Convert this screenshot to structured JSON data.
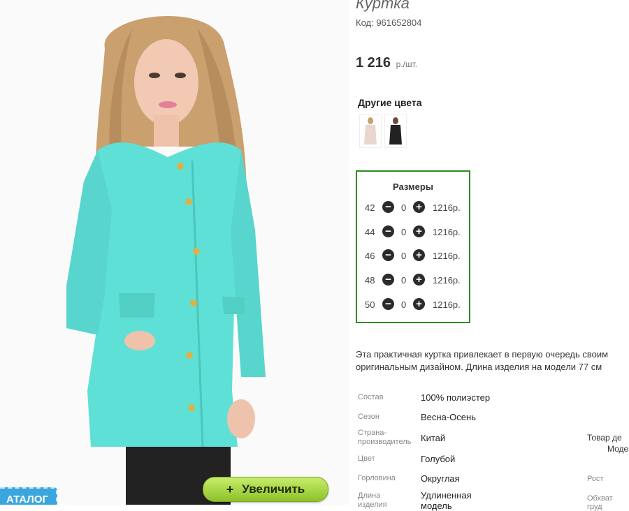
{
  "product": {
    "title": "Куртка",
    "code": "Код: 961652804",
    "price": "1 216",
    "price_unit": "р./шт."
  },
  "photo": {
    "name": "model-photo",
    "jacket_color": "#5fe0d6"
  },
  "zoom_button": {
    "icon": "plus-icon",
    "label": "Увеличить"
  },
  "catalog_tab": {
    "label": "АТАЛОГ"
  },
  "other_colors": {
    "label": "Другие цвета",
    "swatches": [
      {
        "name": "beige",
        "color": "#e9d6cf"
      },
      {
        "name": "black",
        "color": "#222222"
      }
    ]
  },
  "sizes": {
    "title": "Размеры",
    "rows": [
      {
        "size": "42",
        "qty": "0",
        "price": "1216р."
      },
      {
        "size": "44",
        "qty": "0",
        "price": "1216р."
      },
      {
        "size": "46",
        "qty": "0",
        "price": "1216р."
      },
      {
        "size": "48",
        "qty": "0",
        "price": "1216р."
      },
      {
        "size": "50",
        "qty": "0",
        "price": "1216р."
      }
    ]
  },
  "description": "Эта практичная куртка привлекает в первую очередь своим оригинальным дизайном. Длина изделия на модели 77 см",
  "attributes": [
    {
      "label": "Состав",
      "value": "100% полиэстер"
    },
    {
      "label": "Сезон",
      "value": "Весна-Осень"
    },
    {
      "label": "Страна-производитель",
      "value": "Китай"
    },
    {
      "label": "Цвет",
      "value": "Голубой"
    },
    {
      "label": "Горловина",
      "value": "Округлая"
    },
    {
      "label": "Длина изделия",
      "value": "Удлиненная модель"
    }
  ],
  "side": {
    "line1": "Товар де",
    "line2": "Моде",
    "rost": "Рост",
    "obhvat": "Обхват груд"
  },
  "colors": {
    "accent_border": "#2e8b23",
    "button_green": "#9fd23a"
  }
}
